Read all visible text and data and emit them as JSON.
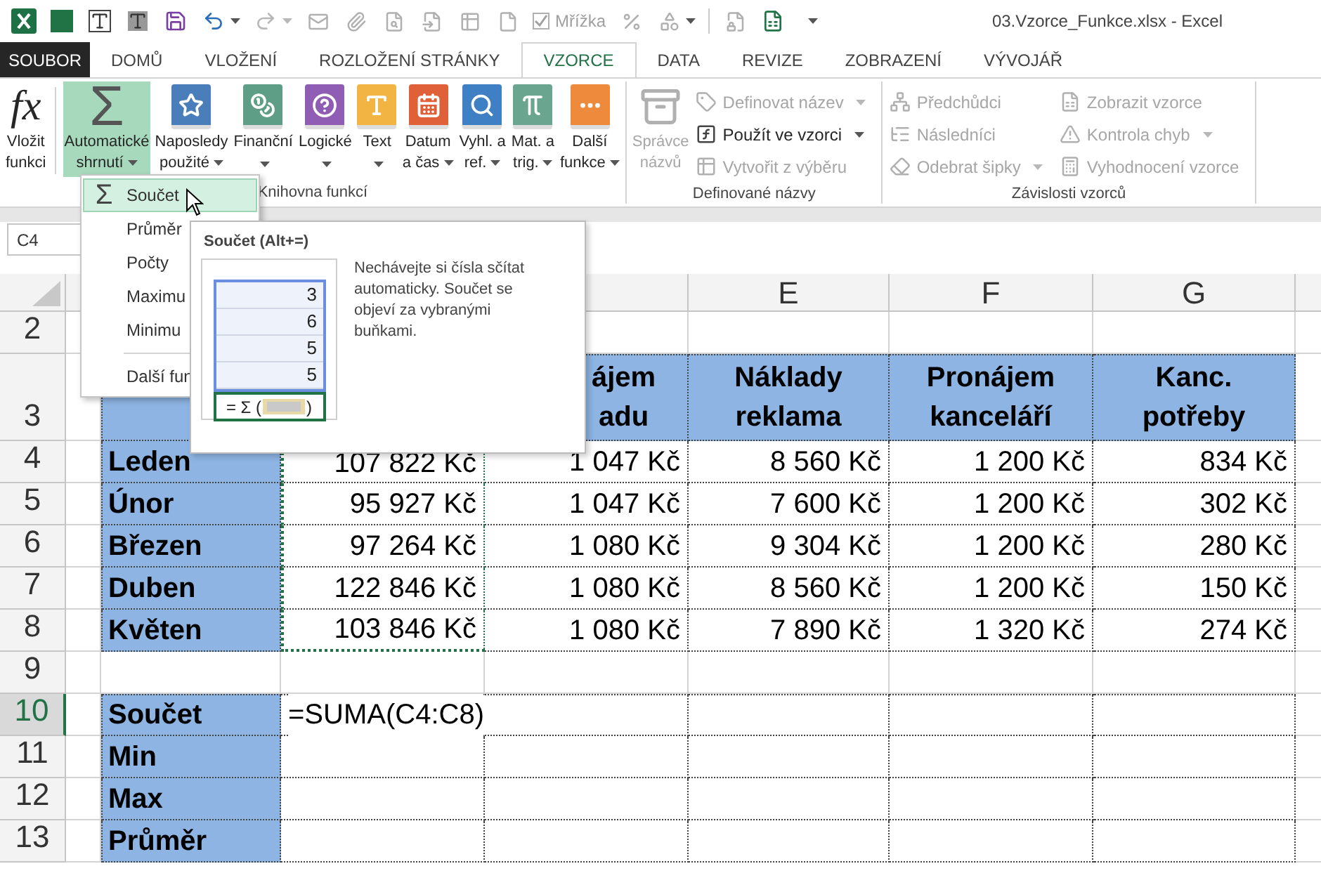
{
  "title_bar": {
    "title": "03.Vzorce_Funkce.xlsx - Excel",
    "gridlines": {
      "label": "Mřížka",
      "checked": true,
      "disabled": true
    }
  },
  "tabs": [
    {
      "label": "SOUBOR",
      "kind": "file",
      "selected": false
    },
    {
      "label": "DOMŮ",
      "kind": "tab",
      "selected": false
    },
    {
      "label": "VLOŽENÍ",
      "kind": "tab",
      "selected": false
    },
    {
      "label": "ROZLOŽENÍ STRÁNKY",
      "kind": "tab",
      "selected": false
    },
    {
      "label": "VZORCE",
      "kind": "tab",
      "selected": true
    },
    {
      "label": "DATA",
      "kind": "tab",
      "selected": false
    },
    {
      "label": "REVIZE",
      "kind": "tab",
      "selected": false
    },
    {
      "label": "ZOBRAZENÍ",
      "kind": "tab",
      "selected": false
    },
    {
      "label": "VÝVOJÁŘ",
      "kind": "tab",
      "selected": false
    }
  ],
  "ribbon": {
    "groups": [
      {
        "label": "Knihovna funkcí",
        "large": [
          {
            "lines": [
              "Vložit",
              "funkci"
            ],
            "icon_text": "fx",
            "pressed": false,
            "disabled": false,
            "dropdown": false
          },
          {
            "lines": [
              "Automatické",
              "shrnutí"
            ],
            "icon_text": "Σ",
            "pressed": true,
            "disabled": false,
            "dropdown": true
          },
          {
            "lines": [
              "Naposledy",
              "použité"
            ],
            "pressed": false,
            "disabled": false,
            "dropdown": true
          },
          {
            "lines": [
              "Finanční"
            ],
            "pressed": false,
            "disabled": false,
            "dropdown": true
          },
          {
            "lines": [
              "Logické"
            ],
            "pressed": false,
            "disabled": false,
            "dropdown": true
          },
          {
            "lines": [
              "Text"
            ],
            "pressed": false,
            "disabled": false,
            "dropdown": true
          },
          {
            "lines": [
              "Datum",
              "a čas"
            ],
            "pressed": false,
            "disabled": false,
            "dropdown": true
          },
          {
            "lines": [
              "Vyhl. a",
              "ref."
            ],
            "pressed": false,
            "disabled": false,
            "dropdown": true
          },
          {
            "lines": [
              "Mat. a",
              "trig."
            ],
            "pressed": false,
            "disabled": false,
            "dropdown": true
          },
          {
            "lines": [
              "Další",
              "funkce"
            ],
            "pressed": false,
            "disabled": false,
            "dropdown": true
          }
        ]
      },
      {
        "label": "Definované názvy",
        "large": [
          {
            "lines": [
              "Správce",
              "názvů"
            ],
            "pressed": false,
            "disabled": true,
            "dropdown": false
          }
        ],
        "small_columns": [
          [
            {
              "label": "Definovat název",
              "disabled": true,
              "dropdown": true
            },
            {
              "label": "Použít ve vzorci",
              "disabled": false,
              "dropdown": true
            },
            {
              "label": "Vytvořit z výběru",
              "disabled": true,
              "dropdown": false
            }
          ]
        ]
      },
      {
        "label": "Závislosti vzorců",
        "small_columns": [
          [
            {
              "label": "Předchůdci",
              "disabled": true,
              "dropdown": false
            },
            {
              "label": "Následníci",
              "disabled": true,
              "dropdown": false
            },
            {
              "label": "Odebrat šipky",
              "disabled": true,
              "dropdown": true
            }
          ],
          [
            {
              "label": "Zobrazit vzorce",
              "disabled": true,
              "dropdown": false
            },
            {
              "label": "Kontrola chyb",
              "disabled": true,
              "dropdown": true
            },
            {
              "label": "Vyhodnocení vzorce",
              "disabled": true,
              "dropdown": false
            }
          ]
        ]
      }
    ]
  },
  "name_box": {
    "value": "C4"
  },
  "sheet": {
    "columns": [
      {
        "label": "E"
      },
      {
        "label": "F"
      },
      {
        "label": "G"
      }
    ],
    "rows": [
      {
        "number": "2",
        "kind": "empty",
        "selected": false
      },
      {
        "number": "3",
        "kind": "header",
        "selected": false,
        "cells": [
          {},
          {},
          {
            "lines": [
              "ájem",
              "adu"
            ],
            "cut_left": true
          },
          {
            "lines": [
              "Náklady",
              "reklama"
            ]
          },
          {
            "lines": [
              "Pronájem",
              "kanceláří"
            ]
          },
          {
            "lines": [
              "Kanc.",
              "potřeby"
            ]
          }
        ]
      },
      {
        "number": "4",
        "kind": "data",
        "selected": false,
        "cells": [
          {
            "text": "Leden"
          },
          {
            "text": "107 822 Kč",
            "marquee": true
          },
          {
            "text": "1 047 Kč"
          },
          {
            "text": "8 560 Kč"
          },
          {
            "text": "1 200 Kč"
          },
          {
            "text": "834 Kč"
          }
        ]
      },
      {
        "number": "5",
        "kind": "data",
        "selected": false,
        "cells": [
          {
            "text": "Únor"
          },
          {
            "text": "95 927 Kč",
            "marquee": true
          },
          {
            "text": "1 047 Kč"
          },
          {
            "text": "7 600 Kč"
          },
          {
            "text": "1 200 Kč"
          },
          {
            "text": "302 Kč"
          }
        ]
      },
      {
        "number": "6",
        "kind": "data",
        "selected": false,
        "cells": [
          {
            "text": "Březen"
          },
          {
            "text": "97 264 Kč",
            "marquee": true
          },
          {
            "text": "1 080 Kč"
          },
          {
            "text": "9 304 Kč"
          },
          {
            "text": "1 200 Kč"
          },
          {
            "text": "280 Kč"
          }
        ]
      },
      {
        "number": "7",
        "kind": "data",
        "selected": false,
        "cells": [
          {
            "text": "Duben"
          },
          {
            "text": "122 846 Kč",
            "marquee": true
          },
          {
            "text": "1 080 Kč"
          },
          {
            "text": "8 560 Kč"
          },
          {
            "text": "1 200 Kč"
          },
          {
            "text": "150 Kč"
          }
        ]
      },
      {
        "number": "8",
        "kind": "data",
        "selected": false,
        "cells": [
          {
            "text": "Květen"
          },
          {
            "text": "103 846 Kč",
            "marquee": true
          },
          {
            "text": "1 080 Kč"
          },
          {
            "text": "7 890 Kč"
          },
          {
            "text": "1 320 Kč"
          },
          {
            "text": "274 Kč"
          }
        ]
      },
      {
        "number": "9",
        "kind": "empty",
        "selected": false
      },
      {
        "number": "10",
        "kind": "data",
        "selected": true,
        "cells": [
          {
            "text": "Součet"
          },
          {
            "text": "=SUMA(C4:C8)",
            "editing": true
          }
        ]
      },
      {
        "number": "11",
        "kind": "data",
        "selected": false,
        "cells": [
          {
            "text": "Min"
          }
        ]
      },
      {
        "number": "12",
        "kind": "data",
        "selected": false,
        "cells": [
          {
            "text": "Max"
          }
        ]
      },
      {
        "number": "13",
        "kind": "data",
        "selected": false,
        "cells": [
          {
            "text": "Průměr"
          }
        ]
      }
    ]
  },
  "menu": {
    "items": [
      {
        "label": "Součet",
        "icon_text": "Σ",
        "selected": true,
        "kind": "item"
      },
      {
        "label": "Průměr",
        "selected": false,
        "kind": "item"
      },
      {
        "label": "Počty",
        "selected": false,
        "kind": "item"
      },
      {
        "label": "Maximu",
        "selected": false,
        "kind": "item"
      },
      {
        "label": "Minimu",
        "selected": false,
        "kind": "item"
      },
      {
        "label": "Další fun",
        "selected": false,
        "kind": "after_separator"
      }
    ]
  },
  "tooltip": {
    "title": "Součet (Alt+=)",
    "sample_values": [
      "3",
      "6",
      "5",
      "5"
    ],
    "formula_prefix": "= Σ (",
    "formula_suffix": ")",
    "description": "Nechávejte si čísla sčítat automaticky. Součet se objeví za vybranými buňkami."
  }
}
